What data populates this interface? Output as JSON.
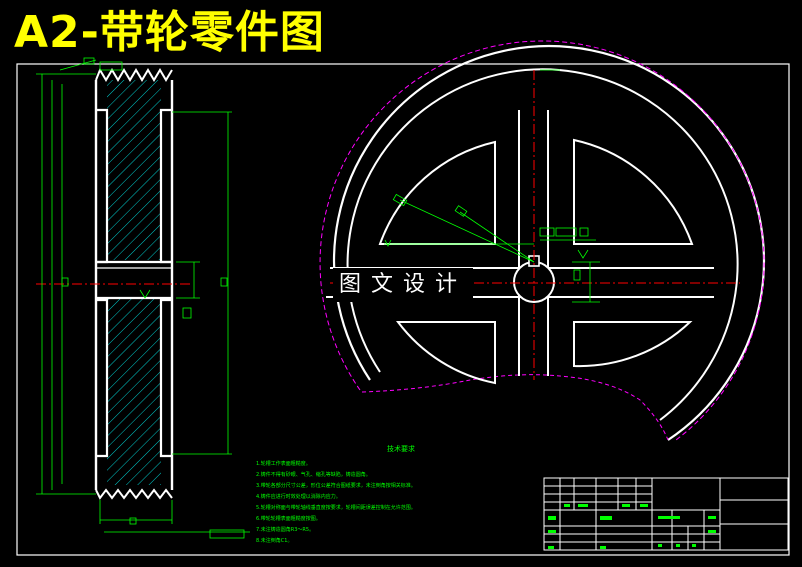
{
  "drawing": {
    "title": "A2-带轮零件图",
    "watermark": "图文设计",
    "technical_requirements": {
      "title": "技术要求",
      "lines": [
        "1.轮槽工作表面粗糙度。",
        "2.铸件不得有砂眼、气孔、缩孔等缺陷，铸造圆角。",
        "3.带轮各部分尺寸公差，形位公差符合图纸要求，未注倒角按相关标准。",
        "4.铸件应进行时效处理以消除内应力。",
        "5.轮槽对称面与带轮轴线垂直度按要求，轮槽间距误差控制在允许范围。",
        "6.带轮轮槽表面粗糙度按图。",
        "7.未注铸造圆角R3～R5。",
        "8.未注倒角C1。"
      ]
    }
  },
  "colors": {
    "background": "#000000",
    "outline": "#ffffff",
    "dimension": "#00ff00",
    "centerline": "#ff0000",
    "hidden": "#ff00ff",
    "hatch": "#00ffff",
    "title": "#ffff00"
  }
}
